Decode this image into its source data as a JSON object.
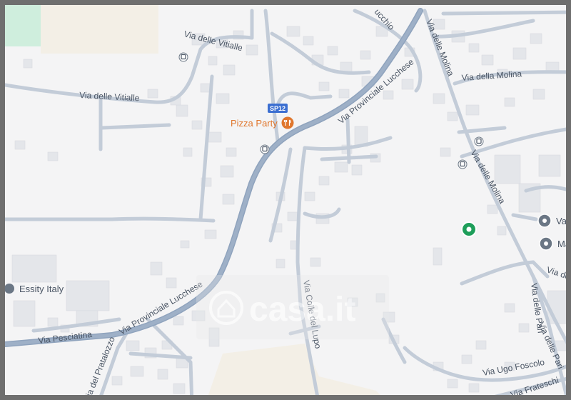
{
  "map": {
    "roads": {
      "provinciale_top": "Via Provinciale Lucchese",
      "provinciale_bottom": "Via Provinciale Lucchese",
      "vitialle_top": "Via delle Vitialle",
      "vitialle_left": "Via delle Vitialle",
      "pesciatina": "Via Pesciatina",
      "colle_del_lupo": "Via Colle del Lupo",
      "molina_top": "Via delle Molina",
      "molina_bottom": "Via delle Molina",
      "della_molina": "Via della Molina",
      "pari_1": "Via delle Pari",
      "pari_2": "Via delle Pari",
      "ugo_foscolo": "Via Ugo Foscolo",
      "frateschi": "Via Frateschi",
      "pratalozzo": "Via del Pratalozzo",
      "lucchio": "ucchio",
      "right_edge": "Via de"
    },
    "shield": "SP12",
    "pois": {
      "pizza_party": "Pizza Party",
      "essity": "Essity Italy",
      "val": "Val",
      "ma": "Ma"
    },
    "watermark": "casa.it",
    "colors": {
      "major_road": "#8fa3bd",
      "minor_road": "#c3ccd8",
      "poi_orange": "#e0772e",
      "location_green": "#1e9e5a",
      "poi_gray": "#6b7785"
    }
  }
}
